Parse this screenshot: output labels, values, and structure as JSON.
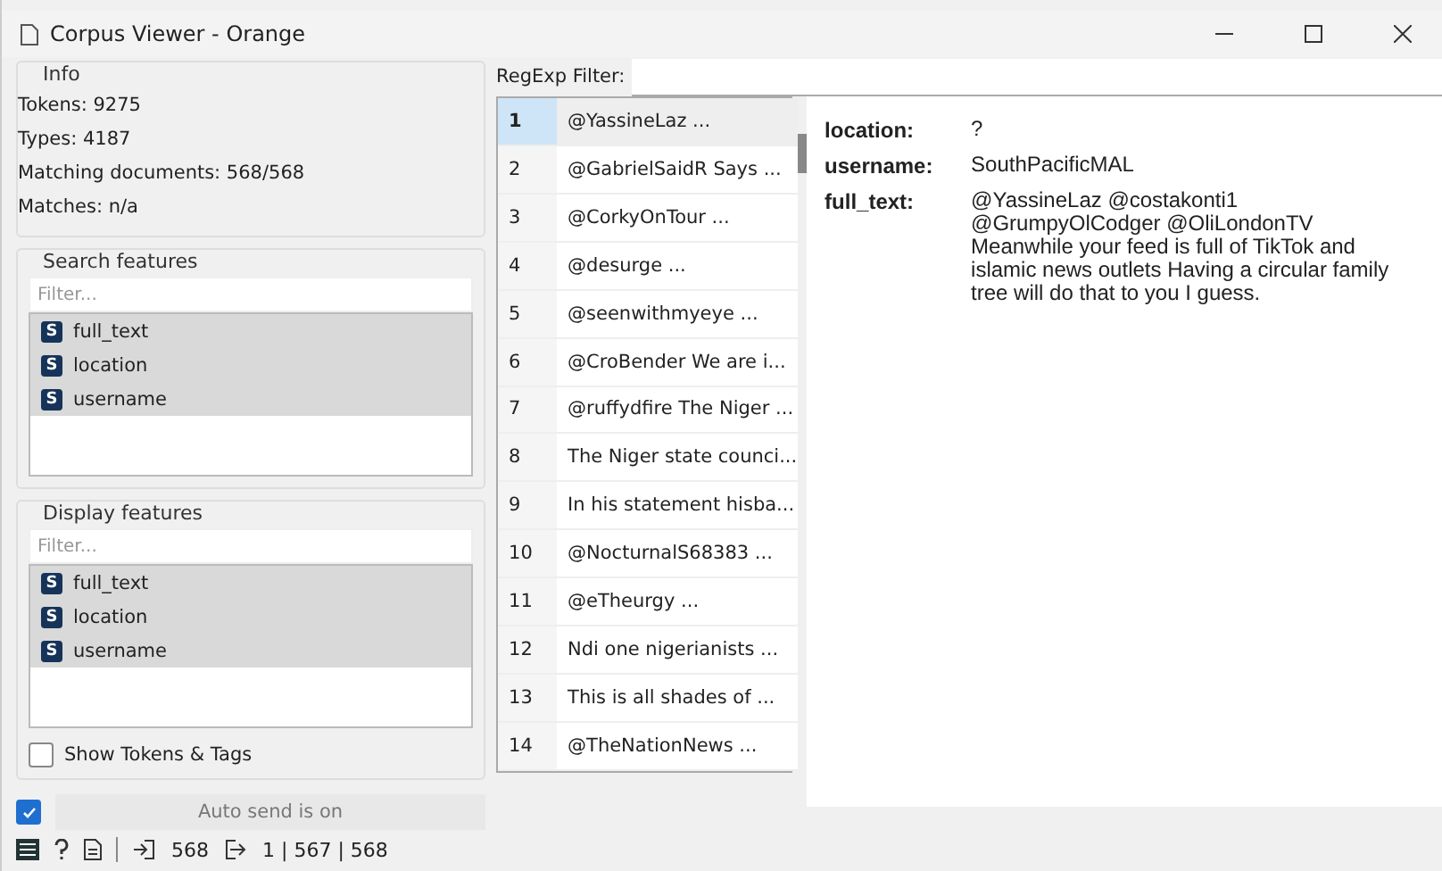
{
  "window": {
    "title": "Corpus Viewer - Orange"
  },
  "info": {
    "title": "Info",
    "lines": [
      "Tokens: 9275",
      "Types: 4187",
      "Matching documents: 568/568",
      "Matches: n/a"
    ]
  },
  "search_features": {
    "title": "Search features",
    "placeholder": "Filter...",
    "items": [
      {
        "badge": "S",
        "label": "full_text",
        "selected": true
      },
      {
        "badge": "S",
        "label": "location",
        "selected": true
      },
      {
        "badge": "S",
        "label": "username",
        "selected": true
      }
    ]
  },
  "display_features": {
    "title": "Display features",
    "placeholder": "Filter...",
    "items": [
      {
        "badge": "S",
        "label": "full_text",
        "selected": true
      },
      {
        "badge": "S",
        "label": "location",
        "selected": true
      },
      {
        "badge": "S",
        "label": "username",
        "selected": true
      }
    ]
  },
  "show_tokens": {
    "label": "Show Tokens & Tags",
    "checked": false
  },
  "auto_send": {
    "label": "Auto send is on",
    "checked": true
  },
  "regexp_filter": {
    "label": "RegExp Filter:"
  },
  "documents": [
    {
      "index": "1",
      "text": "@YassineLaz ...",
      "selected": true
    },
    {
      "index": "2",
      "text": "@GabrielSaidR Says ...",
      "selected": false
    },
    {
      "index": "3",
      "text": "@CorkyOnTour ...",
      "selected": false
    },
    {
      "index": "4",
      "text": "@desurge ...",
      "selected": false
    },
    {
      "index": "5",
      "text": "@seenwithmyeye ...",
      "selected": false
    },
    {
      "index": "6",
      "text": "@CroBender We are i...",
      "selected": false
    },
    {
      "index": "7",
      "text": "@ruffydfire The Niger ...",
      "selected": false
    },
    {
      "index": "8",
      "text": "The Niger state counci...",
      "selected": false
    },
    {
      "index": "9",
      "text": "In his statement hisba...",
      "selected": false
    },
    {
      "index": "10",
      "text": "@NocturnalS68383 ...",
      "selected": false
    },
    {
      "index": "11",
      "text": "@eTheurgy ...",
      "selected": false
    },
    {
      "index": "12",
      "text": "Ndi one nigerianists ...",
      "selected": false
    },
    {
      "index": "13",
      "text": "This is all shades of ...",
      "selected": false
    },
    {
      "index": "14",
      "text": "@TheNationNews ...",
      "selected": false
    }
  ],
  "detail": [
    {
      "key": "location:",
      "value": "?"
    },
    {
      "key": "username:",
      "value": "SouthPacificMAL"
    },
    {
      "key": "full_text:",
      "value": "@YassineLaz @costakonti1 @GrumpyOlCodger @OliLondonTV Meanwhile your feed is full of TikTok and islamic news outlets Having a circular family tree will do that to you I guess."
    }
  ],
  "status_bar": {
    "input_count": "568",
    "output_count": "1 | 567 | 568"
  }
}
